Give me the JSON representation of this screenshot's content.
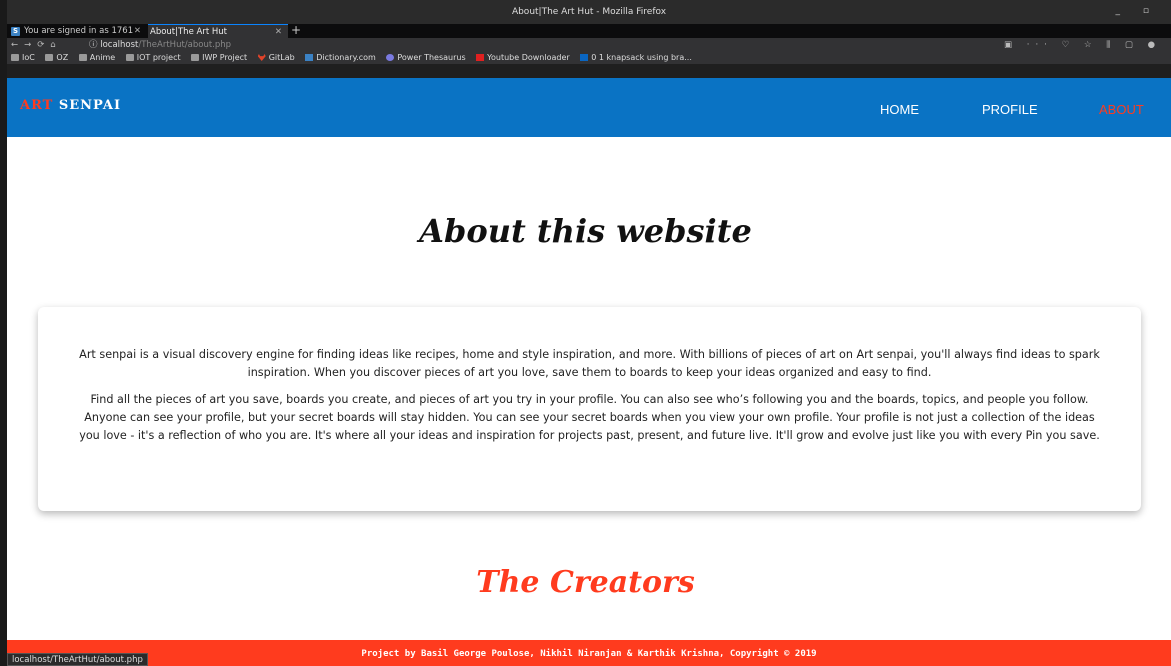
{
  "browser": {
    "window_title": "About|The Art Hut - Mozilla Firefox",
    "tabs": [
      {
        "label": "You are signed in as 1761",
        "favicon": "S",
        "active": false
      },
      {
        "label": "About|The Art Hut",
        "active": true
      }
    ],
    "url_host": "localhost",
    "url_path": "/TheArtHut/about.php",
    "bookmarks": [
      "IoC",
      "OZ",
      "Anime",
      "IOT project",
      "IWP Project",
      "GitLab",
      "Dictionary.com",
      "Power Thesaurus",
      "Youtube Downloader",
      "0 1 knapsack using bra..."
    ],
    "status_url": "localhost/TheArtHut/about.php"
  },
  "site": {
    "logo_art": "ART",
    "logo_senpai": "SENPAI",
    "nav": {
      "home": "HOME",
      "profile": "PROFILE",
      "about": "ABOUT"
    },
    "accent_color": "#ff3b1e",
    "header_color": "#0a73c4"
  },
  "main": {
    "title": "About this website",
    "paragraph1": "Art senpai is a visual discovery engine for finding ideas like recipes, home and style inspiration, and more. With billions of pieces of art on Art senpai, you'll always find ideas to spark inspiration. When you discover pieces of art you love, save them to boards to keep your ideas organized and easy to find.",
    "paragraph2": "Find all the pieces of art you save, boards you create, and pieces of art you try in your profile. You can also see who’s following you and the boards, topics, and people you follow. Anyone can see your profile, but your secret boards will stay hidden. You can see your secret boards when you view your own profile. Your profile is not just a collection of the ideas you love - it's a reflection of who you are. It's where all your ideas and inspiration for projects past, present, and future live. It'll grow and evolve just like you with every Pin you save.",
    "creators_title": "The Creators"
  },
  "footer": {
    "credit": "Project by Basil George Poulose, Nikhil Niranjan & Karthik Krishna, Copyright © 2019"
  }
}
